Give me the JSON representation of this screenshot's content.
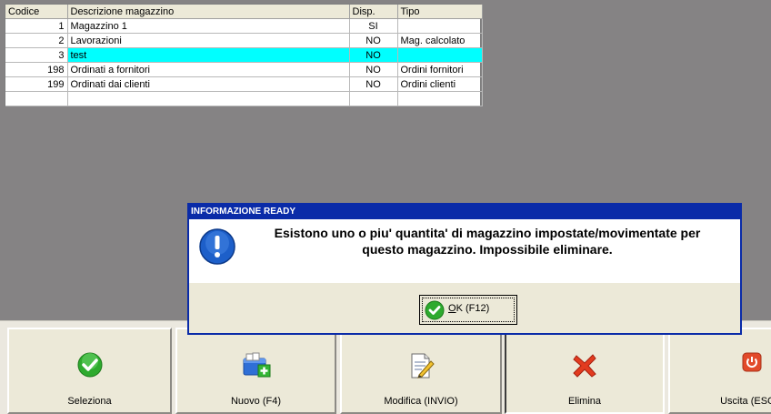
{
  "grid": {
    "headers": [
      "Codice",
      "Descrizione magazzino",
      "Disp.",
      "Tipo"
    ],
    "rows": [
      {
        "codice": "1",
        "descrizione": "Magazzino 1",
        "disp": "SI",
        "tipo": ""
      },
      {
        "codice": "2",
        "descrizione": "Lavorazioni",
        "disp": "NO",
        "tipo": "Mag. calcolato"
      },
      {
        "codice": "3",
        "descrizione": "test",
        "disp": "NO",
        "tipo": ""
      },
      {
        "codice": "198",
        "descrizione": "Ordinati a fornitori",
        "disp": "NO",
        "tipo": "Ordini fornitori"
      },
      {
        "codice": "199",
        "descrizione": "Ordinati dai clienti",
        "disp": "NO",
        "tipo": "Ordini clienti"
      },
      {
        "codice": "",
        "descrizione": "",
        "disp": "",
        "tipo": ""
      }
    ],
    "selected_row_color": "#00ffff"
  },
  "dialog": {
    "title": "INFORMAZIONE READY",
    "message_line1": "Esistono uno o piu' quantita' di magazzino impostate/movimentate per",
    "message_line2": "questo magazzino. Impossibile eliminare.",
    "icon": "info-exclamation-icon",
    "ok_mnemonic": "O",
    "ok_rest": "K (F12)",
    "title_bar_color": "#0a2ba8"
  },
  "toolbar": {
    "buttons": [
      {
        "label": "Seleziona",
        "icon": "check-icon"
      },
      {
        "label": "Nuovo (F4)",
        "icon": "new-folder-icon"
      },
      {
        "label": "Modifica (INVIO)",
        "icon": "edit-document-icon"
      },
      {
        "label": "Elimina",
        "icon": "delete-x-icon"
      },
      {
        "label": "Uscita (ESC",
        "icon": "power-icon"
      }
    ]
  },
  "colors": {
    "background": "#858384",
    "panel": "#ece9d8",
    "accent_green": "#2eaa2e",
    "delete_red": "#e23b1f"
  }
}
